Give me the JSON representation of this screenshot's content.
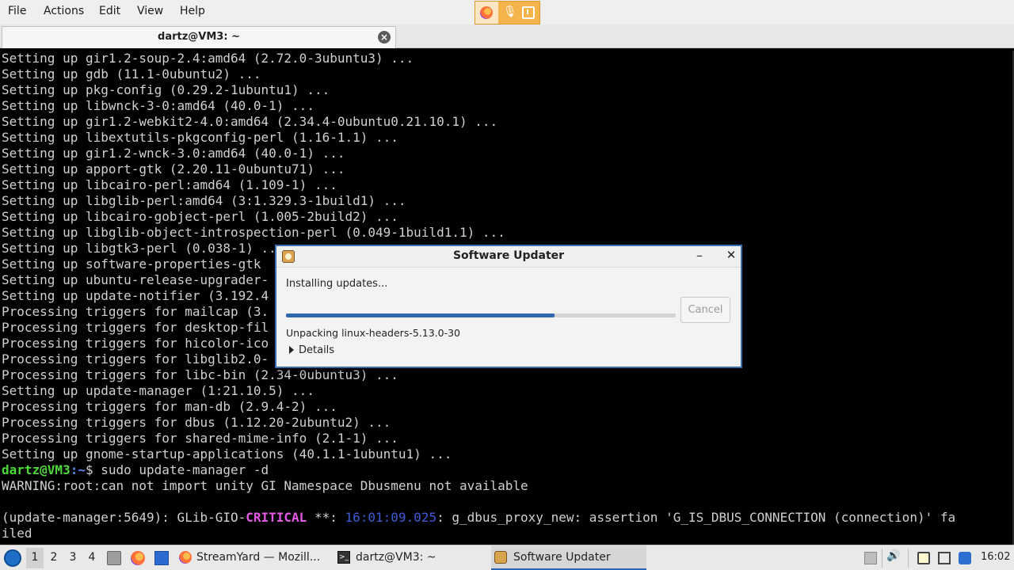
{
  "menubar": {
    "items": [
      "File",
      "Actions",
      "Edit",
      "View",
      "Help"
    ]
  },
  "terminal_tab": {
    "title": "dartz@VM3: ~",
    "close_icon": "close-icon"
  },
  "terminal": {
    "lines": [
      "Setting up gir1.2-soup-2.4:amd64 (2.72.0-3ubuntu3) ...",
      "Setting up gdb (11.1-0ubuntu2) ...",
      "Setting up pkg-config (0.29.2-1ubuntu1) ...",
      "Setting up libwnck-3-0:amd64 (40.0-1) ...",
      "Setting up gir1.2-webkit2-4.0:amd64 (2.34.4-0ubuntu0.21.10.1) ...",
      "Setting up libextutils-pkgconfig-perl (1.16-1.1) ...",
      "Setting up gir1.2-wnck-3.0:amd64 (40.0-1) ...",
      "Setting up apport-gtk (2.20.11-0ubuntu71) ...",
      "Setting up libcairo-perl:amd64 (1.109-1) ...",
      "Setting up libglib-perl:amd64 (3:1.329.3-1build1) ...",
      "Setting up libcairo-gobject-perl (1.005-2build2) ...",
      "Setting up libglib-object-introspection-perl (0.049-1build1.1) ...",
      "Setting up libgtk3-perl (0.038-1) ...",
      "Setting up software-properties-gtk",
      "Setting up ubuntu-release-upgrader-",
      "Setting up update-notifier (3.192.4",
      "Processing triggers for mailcap (3.",
      "Processing triggers for desktop-fil",
      "Processing triggers for hicolor-ico",
      "Processing triggers for libglib2.0-",
      "Processing triggers for libc-bin (2.34-0ubuntu3) ...",
      "Setting up update-manager (1:21.10.5) ...",
      "Processing triggers for man-db (2.9.4-2) ...",
      "Processing triggers for dbus (1.12.20-2ubuntu2) ...",
      "Processing triggers for shared-mime-info (2.1-1) ...",
      "Setting up gnome-startup-applications (40.1.1-1ubuntu1) ..."
    ],
    "prompt": {
      "user": "dartz@VM3",
      "path": ":~",
      "symbol": "$",
      "command": " sudo update-manager -d"
    },
    "warning": "WARNING:root:can not import unity GI Namespace Dbusmenu not available",
    "critical": {
      "prefix": "(update-manager:5649): GLib-GIO-",
      "level": "CRITICAL",
      "mid": " **: ",
      "timestamp": "16:01:09.025",
      "message": ": g_dbus_proxy_new: assertion 'G_IS_DBUS_CONNECTION (connection)' fa",
      "wrap": "iled"
    }
  },
  "dialog": {
    "title": "Software Updater",
    "status": "Installing updates...",
    "progress": 0.69,
    "cancel_label": "Cancel",
    "detail": "Unpacking linux-headers-5.13.0-30",
    "expander_label": "Details"
  },
  "taskbar": {
    "workspaces": [
      "1",
      "2",
      "3",
      "4"
    ],
    "active_workspace": "1",
    "tasks": [
      {
        "label": "StreamYard — Mozill...",
        "icon": "firefox-icon"
      },
      {
        "label": "dartz@VM3: ~",
        "icon": "terminal-icon"
      },
      {
        "label": "Software Updater",
        "icon": "software-updater-icon"
      }
    ],
    "clock": "16:02"
  },
  "colors": {
    "accent": "#2f67b0",
    "terminal_bg": "#000000",
    "prompt_user": "#4ed83a",
    "prompt_path": "#5b8cf0",
    "critical": "#e858e8",
    "timestamp": "#3e5bd6"
  }
}
